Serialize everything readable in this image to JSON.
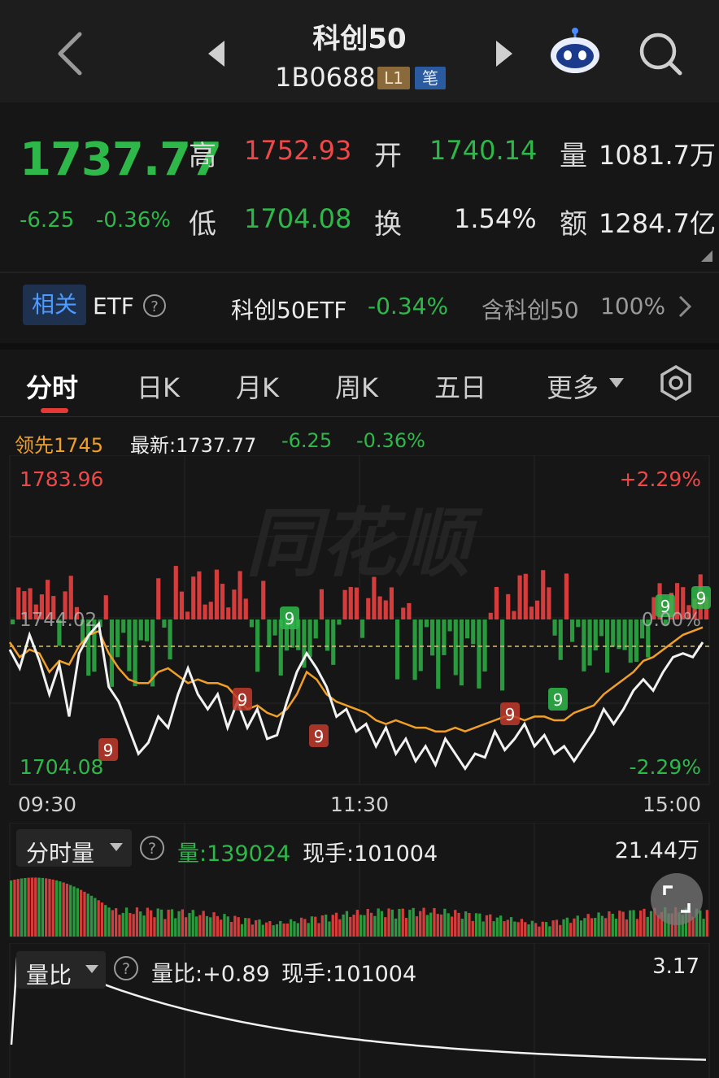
{
  "header": {
    "title": "科创50",
    "code": "1B0688",
    "badge_level": "L1",
    "badge_tick": "笔",
    "icons": [
      "back-arrow-icon",
      "prev-icon",
      "next-icon",
      "robot-icon",
      "search-icon"
    ]
  },
  "quote": {
    "price": "1737.77",
    "change": "-6.25",
    "change_pct": "-0.36%",
    "high_label": "高",
    "high": "1752.93",
    "open_label": "开",
    "open": "1740.14",
    "volume_label": "量",
    "volume": "1081.7万",
    "low_label": "低",
    "low": "1704.08",
    "turnover_label": "换",
    "turnover": "1.54%",
    "amount_label": "额",
    "amount": "1284.7亿"
  },
  "etf": {
    "tag": "相关",
    "label": "ETF",
    "name": "科创50ETF",
    "change": "-0.34%",
    "contains": "含科创50",
    "weight": "100%"
  },
  "tabs": {
    "items": [
      "分时",
      "日K",
      "月K",
      "周K",
      "五日",
      "更多"
    ],
    "active": "分时"
  },
  "chart_info": {
    "leader_label": "领先1745",
    "latest_label": "最新:1737.77",
    "change": "-6.25",
    "change_pct": "-0.36%",
    "watermark": "同花顺"
  },
  "chart_data": {
    "type": "line",
    "price_axis": {
      "max": "1783.96",
      "prev_close": "1744.02",
      "min": "1704.08"
    },
    "pct_axis": {
      "max": "+2.29%",
      "mid": "0.00%",
      "min": "-2.29%"
    },
    "time_labels": [
      "09:30",
      "11:30",
      "15:00"
    ],
    "ylim": [
      1704.08,
      1783.96
    ],
    "prev_close": 1744.02,
    "series": [
      {
        "values": [
          1736,
          1731,
          1740,
          1733,
          1724,
          1732,
          1718,
          1735,
          1740,
          1743,
          1726,
          1722,
          1715,
          1708,
          1711,
          1718,
          1715,
          1724,
          1731,
          1724,
          1720,
          1724,
          1715,
          1722,
          1715,
          1720,
          1712,
          1713,
          1722,
          1730,
          1735,
          1731,
          1726,
          1718,
          1720,
          1714,
          1716,
          1710,
          1715,
          1708,
          1712,
          1706,
          1710,
          1705,
          1712,
          1708,
          1704,
          1708,
          1707,
          1714,
          1709,
          1712,
          1716,
          1710,
          1713,
          1708,
          1710,
          1706,
          1710,
          1714,
          1720,
          1716,
          1720,
          1725,
          1728,
          1725,
          1730,
          1734,
          1735,
          1734,
          1738
        ]
      },
      {
        "values": [
          1738,
          1734,
          1736,
          1735,
          1730,
          1733,
          1732,
          1737,
          1740,
          1741,
          1735,
          1731,
          1728,
          1727,
          1727,
          1730,
          1731,
          1729,
          1727,
          1728,
          1727,
          1727,
          1726,
          1723,
          1720,
          1721,
          1719,
          1718,
          1720,
          1724,
          1730,
          1728,
          1724,
          1722,
          1721,
          1720,
          1719,
          1717,
          1716,
          1717,
          1716,
          1715,
          1715,
          1714,
          1714,
          1715,
          1714,
          1715,
          1716,
          1717,
          1718,
          1718,
          1717,
          1718,
          1718,
          1717,
          1717,
          1719,
          1720,
          1721,
          1724,
          1726,
          1728,
          1730,
          1733,
          1734,
          1736,
          1738,
          1740,
          1741,
          1742
        ]
      }
    ]
  },
  "volume_panel": {
    "title": "分时量",
    "vol_label": "量:139024",
    "hand_label": "现手:101004",
    "max": "21.44万"
  },
  "ratio_panel": {
    "title": "量比",
    "ratio_label": "量比:+0.89",
    "hand_label": "现手:101004",
    "max": "3.17"
  },
  "colors": {
    "up": "#ef4848",
    "down": "#2eb84a",
    "avg": "#f0a028",
    "price": "#f2f2f2"
  }
}
